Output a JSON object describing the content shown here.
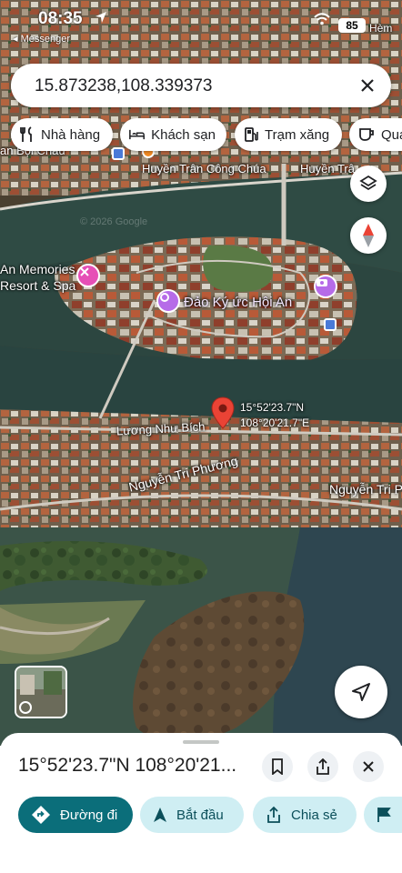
{
  "status_bar": {
    "time": "08:35",
    "back_app": "◂ Messenger",
    "battery": "85"
  },
  "search": {
    "query": "15.873238,108.339373"
  },
  "chips": [
    {
      "label": "Nhà hàng",
      "icon": "fork-knife-icon"
    },
    {
      "label": "Khách sạn",
      "icon": "bed-icon"
    },
    {
      "label": "Trạm xăng",
      "icon": "gas-pump-icon"
    },
    {
      "label": "Quá",
      "icon": "coffee-cup-icon"
    }
  ],
  "map": {
    "labels": {
      "hem": "Hèm",
      "boi_chau": "an Bội Châu",
      "huyen_tran_1": "Huyền Trân Công Chúa",
      "huyen_tran_2": "Huyền Trâ",
      "memories_1": "An Memories",
      "memories_2": "Resort & Spa",
      "dao_ky_uc": "Đảo Ký ức Hội An",
      "luong_nhu_bich": "Lương Như Bích",
      "nguyen_tri_phuong_1": "Nguyễn Tri Phương",
      "nguyen_tri_phuong_2": "Nguyễn Tri P"
    },
    "pin_coords": {
      "lat": "15°52'23.7\"N",
      "lng": "108°20'21.7\"E"
    },
    "watermark": "© 2026 Google"
  },
  "place": {
    "title": "15°52'23.7\"N 108°20'21..."
  },
  "actions": {
    "directions": "Đường đi",
    "start": "Bắt đầu",
    "share": "Chia sẻ"
  },
  "colors": {
    "accent": "#0b6e7a",
    "secondary_bg": "#cfeef3",
    "pin": "#ea4335",
    "poi": "#b66be8"
  }
}
